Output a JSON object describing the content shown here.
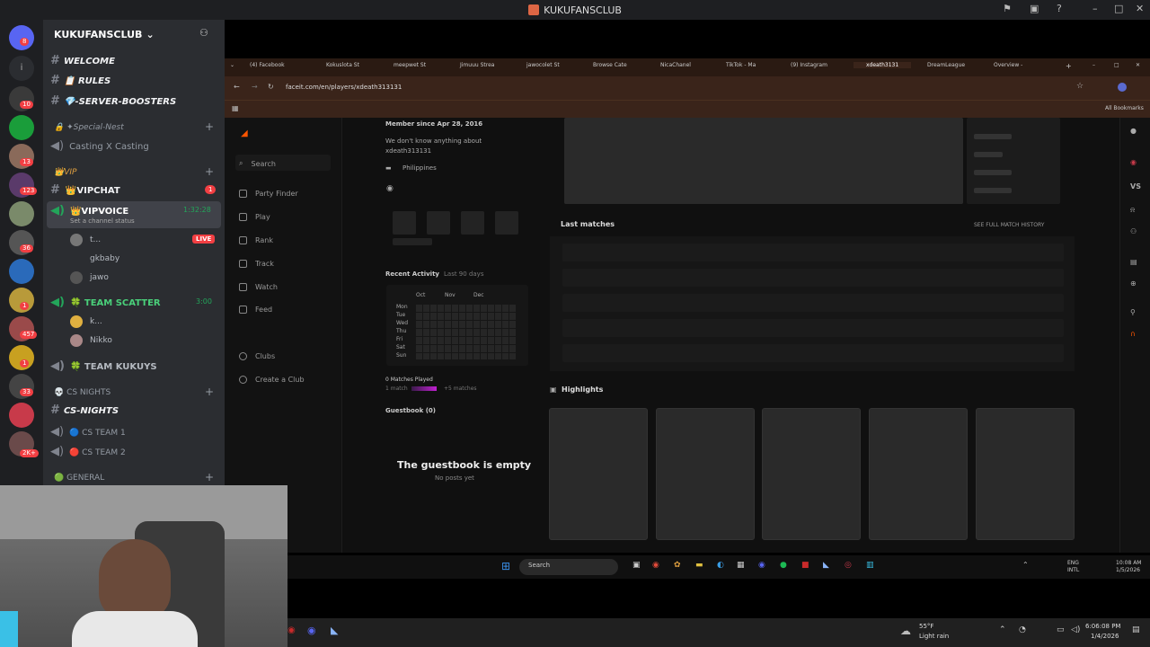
{
  "window": {
    "title": "KUKUFANSCLUB"
  },
  "server_badges": [
    "8",
    "10",
    "13",
    "123",
    "36",
    "1",
    "457",
    "1",
    "33",
    "2K+"
  ],
  "channels": {
    "server_name": "KUKUFANSCLUB",
    "welcome": "WELCOME",
    "rules": "📋 RULES",
    "boosters": "💎-SERVER-BOOSTERS",
    "cat_special": "🔒 ✦Special-Nest",
    "casting": "Casting X Casting",
    "cat_vip": "👑VIP",
    "vipchat": "👑VIPCHAT",
    "vipchat_badge": "1",
    "vipvoice": "👑VIPVOICE",
    "vipvoice_time": "1:32:28",
    "vipvoice_status": "Set a channel status",
    "users_vip": [
      "t...",
      "gkbaby",
      "jawo"
    ],
    "live": "LIVE",
    "team_scatter": "🍀 TEAM SCATTER",
    "team_scatter_time": "3:00",
    "users_scatter": [
      "k...",
      "Nikko"
    ],
    "team_kukuys": "🍀 TEAM KUKUYS",
    "cat_csnights": "💀 CS NIGHTS",
    "cs_nights": "CS-NIGHTS",
    "cs_team1": "🔵 CS TEAM 1",
    "cs_team2": "🔴 CS TEAM 2",
    "cat_general": "🟢 GENERAL"
  },
  "browser": {
    "tabs": [
      "(4) Facebook",
      "Kokuslota St",
      "meepwet St",
      "Jimuuu Strea",
      "jawocolet St",
      "Browse Cate",
      "NicaChanel",
      "TikTok - Ma",
      "(9) Instagram",
      "xdeath3131",
      "DreamLeague",
      "Overview - "
    ],
    "url": "faceit.com/en/players/xdeath313131",
    "bookmarks": "All Bookmarks"
  },
  "faceit": {
    "nav": [
      "Search",
      "Party Finder",
      "Play",
      "Rank",
      "Track",
      "Watch",
      "Feed",
      "Clubs",
      "Create a Club"
    ],
    "member_since": "Member since Apr 28, 2016",
    "about": "We don't know anything about",
    "about2": "xdeath313131",
    "country": "Philippines",
    "recent_activity": "Recent Activity",
    "last_days": "Last 90 days",
    "months": [
      "Oct",
      "Nov",
      "Dec"
    ],
    "days": [
      "Mon",
      "Tue",
      "Wed",
      "Thu",
      "Fri",
      "Sat",
      "Sun"
    ],
    "matches_played": "0 Matches Played",
    "match_legend_1": "1 match",
    "match_legend_2": "+5 matches",
    "guestbook": "Guestbook (0)",
    "guestbook_empty": "The guestbook is empty",
    "no_posts": "No posts yet",
    "last_matches": "Last matches",
    "see_full": "SEE FULL MATCH HISTORY",
    "highlights": "Highlights",
    "vs": "VS"
  },
  "inner_taskbar": {
    "search": "Search",
    "lang": "ENG",
    "lang2": "INTL",
    "time": "10:08 AM",
    "date": "1/5/2026"
  },
  "outer_taskbar": {
    "temp": "55°F",
    "weather": "Light rain",
    "time": "6:06:08 PM",
    "date": "1/4/2026"
  }
}
